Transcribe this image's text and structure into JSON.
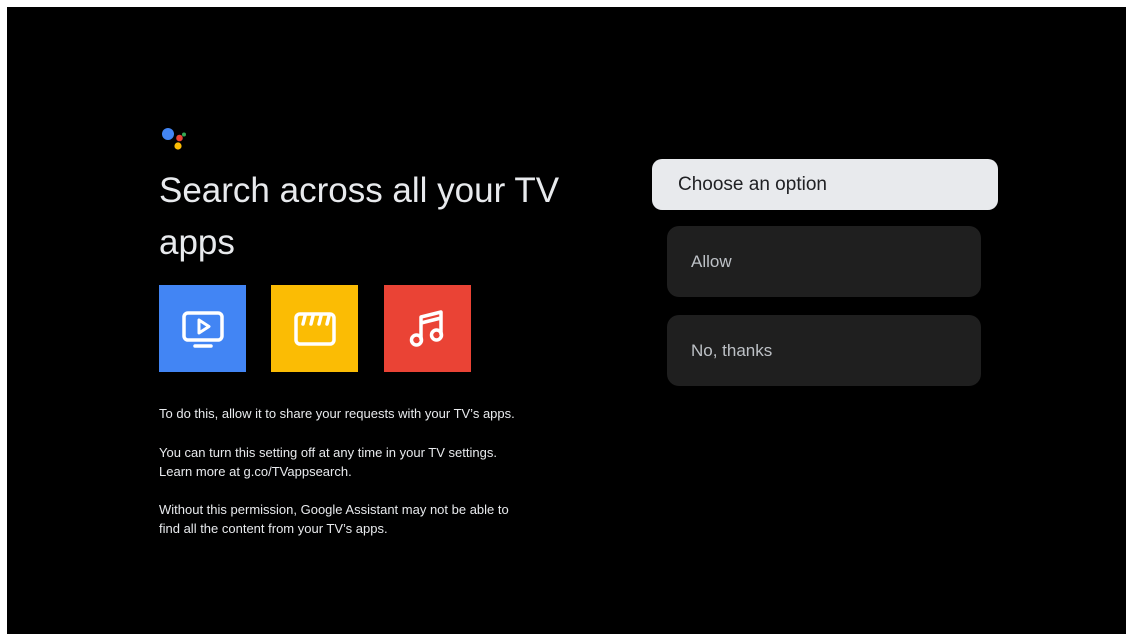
{
  "left_panel": {
    "title": "Search across all your TV apps",
    "tiles": [
      {
        "icon": "tv-play-icon",
        "color": "#4285f4"
      },
      {
        "icon": "clapperboard-icon",
        "color": "#fbbc04"
      },
      {
        "icon": "music-note-icon",
        "color": "#ea4335"
      }
    ],
    "paragraph_1": "To do this, allow it to share your requests with your TV’s apps.",
    "paragraph_2_line_1": "You can turn this setting off at any time in your TV settings.",
    "paragraph_2_line_2": "Learn more at g.co/TVappsearch.",
    "paragraph_3_line_1": "Without this permission, Google Assistant may not be able to",
    "paragraph_3_line_2": "find all the content from your TV’s apps."
  },
  "options": {
    "header": "Choose an option",
    "allow_label": "Allow",
    "decline_label": "No, thanks"
  },
  "colors": {
    "background": "#000000",
    "text": "#e8eaed",
    "option_bg": "#1f1f1f",
    "header_bg": "#e8eaed"
  }
}
